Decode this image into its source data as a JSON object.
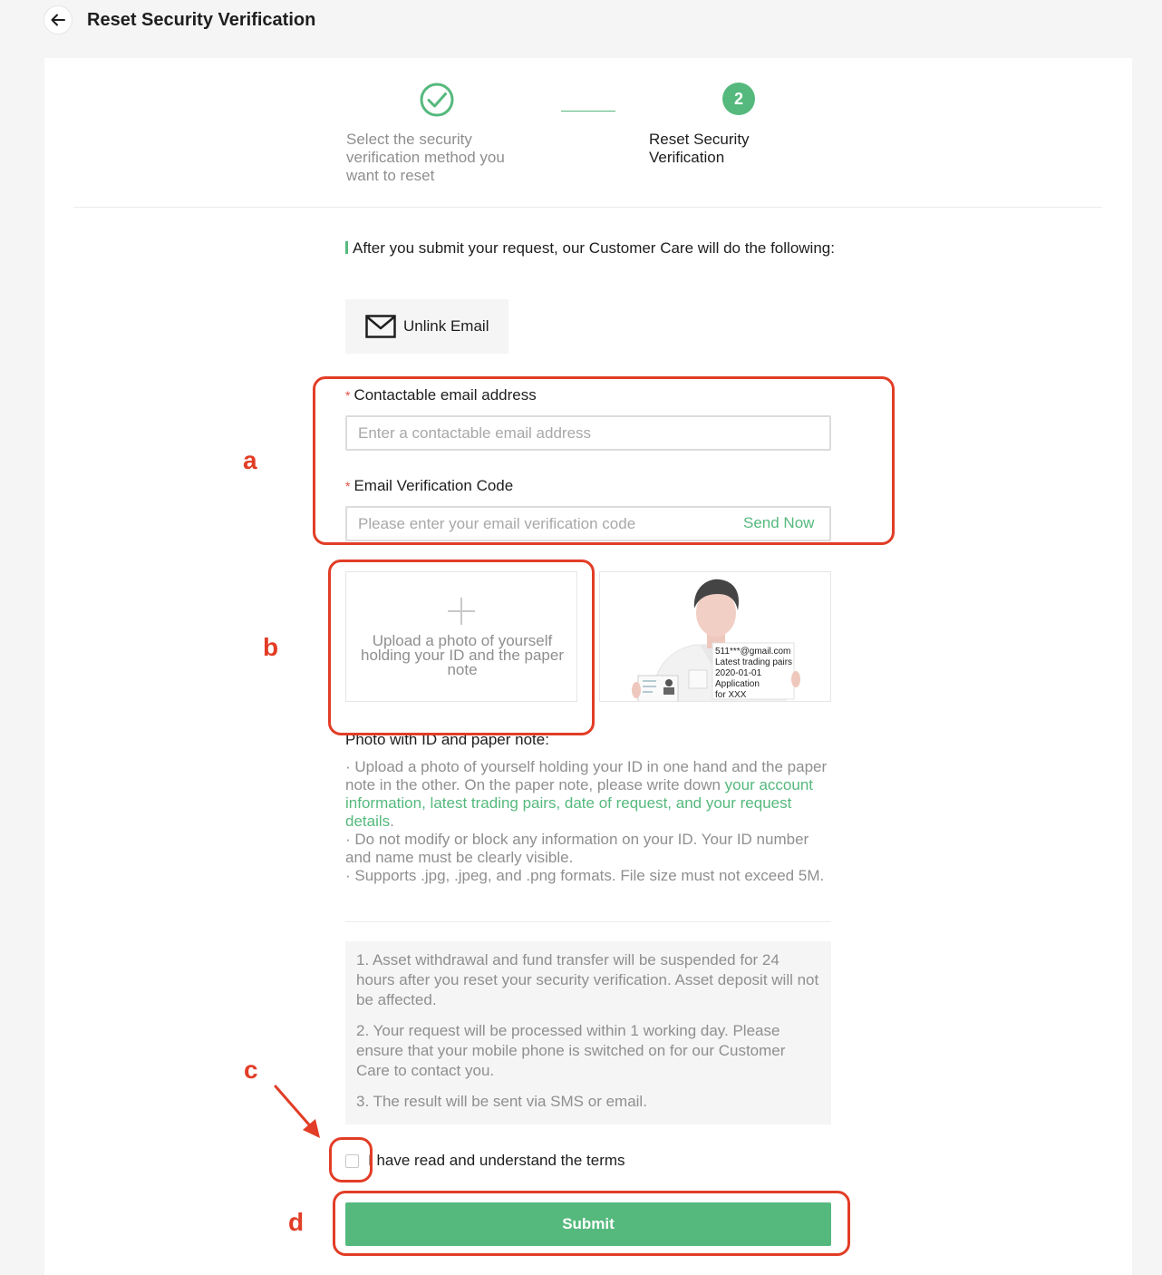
{
  "header": {
    "title": "Reset Security Verification"
  },
  "stepper": {
    "step1_label": "Select the security verification method you want to reset",
    "step2_number": "2",
    "step2_label": "Reset Security Verification"
  },
  "intro": "After you submit your request, our Customer Care will do the following:",
  "unlink": {
    "label": "Unlink Email"
  },
  "form": {
    "email_label": "Contactable email address",
    "email_placeholder": "Enter a contactable email address",
    "code_label": "Email Verification Code",
    "code_placeholder": "Please enter your email verification code",
    "send_now": "Send Now",
    "required_mark": "*"
  },
  "upload": {
    "text": "Upload a photo of yourself holding your ID and the paper note",
    "example_note": [
      "511***@gmail.com",
      "Latest trading pairs",
      "2020-01-01",
      "Application",
      "for XXX"
    ]
  },
  "instructions": {
    "title": "Photo with ID and paper note:",
    "line1_prefix": "· Upload a photo of yourself holding your ID in one hand and the paper note in the other. On the paper note, please write down ",
    "line1_highlight": "your account information, latest trading pairs, date of request, and your request details",
    "line1_suffix": ".",
    "line2": "· Do not modify or block any information on your ID. Your ID number and name must be clearly visible.",
    "line3": "· Supports .jpg, .jpeg, and .png formats. File size must not exceed 5M."
  },
  "notice": [
    "1. Asset withdrawal and fund transfer will be suspended for 24 hours after you reset your security verification. Asset deposit will not be affected.",
    "2. Your request will be processed within 1 working day. Please ensure that your mobile phone is switched on for our Customer Care to contact you.",
    "3. The result will be sent via SMS or email."
  ],
  "terms": {
    "label": "I have read and understand the terms",
    "checked": false
  },
  "submit": {
    "label": "Submit"
  },
  "annotations": {
    "a": "a",
    "b": "b",
    "c": "c",
    "d": "d"
  },
  "colors": {
    "accent": "#55b97d",
    "annotation": "#e23d26"
  }
}
